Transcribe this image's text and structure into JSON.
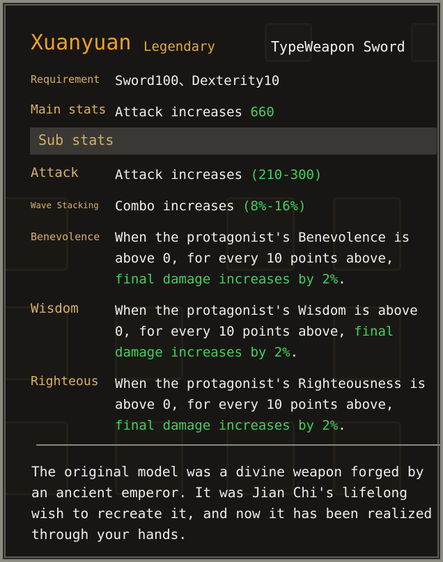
{
  "item": {
    "name": "Xuanyuan",
    "rarity": "Legendary",
    "type": "TypeWeapon Sword"
  },
  "requirement": {
    "label": "Requirement",
    "value": "Sword100、Dexterity10"
  },
  "main_stats": {
    "label": "Main stats",
    "text": "Attack increases ",
    "value": "660"
  },
  "sub_stats": {
    "header": "Sub stats",
    "entries": [
      {
        "label": "Attack",
        "text": "Attack increases ",
        "highlight": "(210-300)"
      },
      {
        "label": "Wave Stacking",
        "text": "Combo increases ",
        "highlight": "(8%-16%)"
      },
      {
        "label": "Benevolence",
        "text": "When the protagonist's Benevolence is above 0, for every 10 points above, ",
        "highlight": "final damage increases by 2%",
        "suffix": "."
      },
      {
        "label": "Wisdom",
        "text": "When the protagonist's Wisdom is above 0, for every 10 points above, ",
        "highlight": "final damage increases by 2%",
        "suffix": "."
      },
      {
        "label": "Righteous",
        "text": "When the protagonist's Righteousness is above 0, for every 10 points above, ",
        "highlight": "final damage increases by 2%",
        "suffix": "."
      }
    ]
  },
  "lore": "The original model was a divine weapon forged by an ancient emperor. It was Jian Chi's lifelong wish to recreate it, and now it has been realized through your hands.",
  "colors": {
    "name": "#ec9f2a",
    "label": "#d9b062",
    "highlight": "#3fd25a",
    "text": "#eeeeea"
  }
}
